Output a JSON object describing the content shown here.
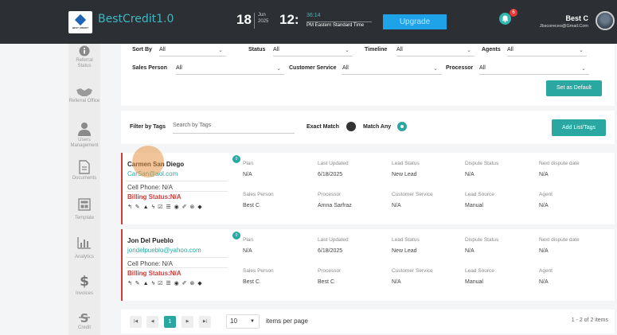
{
  "header": {
    "brand": "BestCredit1.0",
    "logo_text": "BEST CREDIT",
    "date_day": "18",
    "date_month": "Jun",
    "date_year": "2025",
    "time_hm": "12:",
    "time_seconds": "36:14",
    "time_ampm": "PM",
    "timezone": "Eastern Standard Time",
    "upgrade_label": "Upgrade",
    "notification_count": "6",
    "user_name": "Best C",
    "user_email": "Jbscoreceo@Gmail.Com"
  },
  "sidebar": [
    {
      "label": "Referral Status",
      "icon": "info-icon"
    },
    {
      "label": "Referral Office",
      "icon": "handshake-icon"
    },
    {
      "label": "Users Management",
      "icon": "user-icon"
    },
    {
      "label": "Documents",
      "icon": "document-icon"
    },
    {
      "label": "Template",
      "icon": "template-icon"
    },
    {
      "label": "Analytics",
      "icon": "bar-chart-icon"
    },
    {
      "label": "Invoices",
      "icon": "dollar-icon"
    },
    {
      "label": "Credit",
      "icon": "strike-s-icon"
    }
  ],
  "filters": {
    "sort_by": {
      "label": "Sort By",
      "value": "All"
    },
    "status": {
      "label": "Status",
      "value": "All"
    },
    "timeline": {
      "label": "Timeline",
      "value": "All"
    },
    "agents": {
      "label": "Agents",
      "value": "All"
    },
    "sales_person": {
      "label": "Sales Person",
      "value": "All"
    },
    "customer_service": {
      "label": "Customer Service",
      "value": "All"
    },
    "processor": {
      "label": "Processor",
      "value": "All"
    },
    "set_default_label": "Set as Default"
  },
  "tags": {
    "label": "Filter by Tags",
    "placeholder": "Search by Tags",
    "exact_match": "Exact Match",
    "match_any": "Match Any",
    "add_label": "Add List/Tags"
  },
  "field_headers": {
    "plan": "Plan",
    "last_updated": "Last Updated",
    "lead_status": "Lead Status",
    "dispute_status": "Dispute Status",
    "next_dispute": "Next dispute date",
    "sales_person": "Sales Person",
    "processor": "Processor",
    "customer_service": "Customer Service",
    "lead_source": "Lead Source",
    "agent": "Agent"
  },
  "records": [
    {
      "badge": "0",
      "name": "Carmen San Diego",
      "email": "CarSan@aol.com",
      "phone": "Cell Phone: N/A",
      "billing": "Billing Status:N/A",
      "plan": "N/A",
      "last_updated": "6/18/2025",
      "lead_status": "New Lead",
      "dispute_status": "N/A",
      "next_dispute": "N/A",
      "sales_person": "Best C",
      "processor": "Amna Sarfraz",
      "customer_service": "N/A",
      "lead_source": "Manual",
      "agent": "N/A"
    },
    {
      "badge": "0",
      "name": "Jon Del Pueblo",
      "email": "jondelpueblo@yahoo.com",
      "phone": "Cell Phone: N/A",
      "billing": "Billing Status:N/A",
      "plan": "N/A",
      "last_updated": "6/18/2025",
      "lead_status": "New Lead",
      "dispute_status": "N/A",
      "next_dispute": "N/A",
      "sales_person": "Best C",
      "processor": "Best C",
      "customer_service": "N/A",
      "lead_source": "Manual",
      "agent": "N/A"
    }
  ],
  "action_icons": "↰ ✎ ▲ ϟ ☑ ☰ ◉ ✐ ⊗ ◆",
  "pager": {
    "first": "|◀",
    "prev": "◀",
    "current": "1",
    "next": "▶",
    "last": "▶|",
    "page_size": "10",
    "items_label": "items per page",
    "count": "1 - 2 of 2 items"
  }
}
